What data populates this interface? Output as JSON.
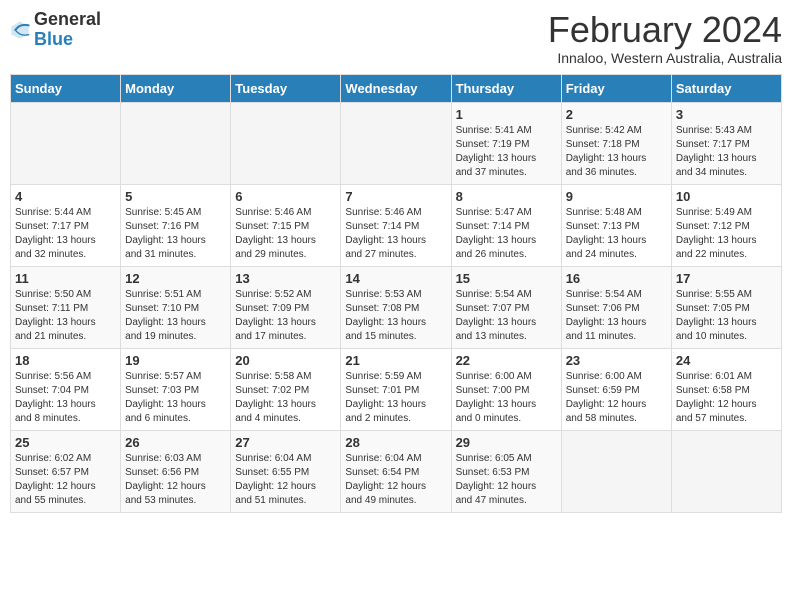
{
  "logo": {
    "general": "General",
    "blue": "Blue"
  },
  "header": {
    "month": "February 2024",
    "location": "Innaloo, Western Australia, Australia"
  },
  "weekdays": [
    "Sunday",
    "Monday",
    "Tuesday",
    "Wednesday",
    "Thursday",
    "Friday",
    "Saturday"
  ],
  "weeks": [
    [
      {
        "day": "",
        "info": ""
      },
      {
        "day": "",
        "info": ""
      },
      {
        "day": "",
        "info": ""
      },
      {
        "day": "",
        "info": ""
      },
      {
        "day": "1",
        "info": "Sunrise: 5:41 AM\nSunset: 7:19 PM\nDaylight: 13 hours\nand 37 minutes."
      },
      {
        "day": "2",
        "info": "Sunrise: 5:42 AM\nSunset: 7:18 PM\nDaylight: 13 hours\nand 36 minutes."
      },
      {
        "day": "3",
        "info": "Sunrise: 5:43 AM\nSunset: 7:17 PM\nDaylight: 13 hours\nand 34 minutes."
      }
    ],
    [
      {
        "day": "4",
        "info": "Sunrise: 5:44 AM\nSunset: 7:17 PM\nDaylight: 13 hours\nand 32 minutes."
      },
      {
        "day": "5",
        "info": "Sunrise: 5:45 AM\nSunset: 7:16 PM\nDaylight: 13 hours\nand 31 minutes."
      },
      {
        "day": "6",
        "info": "Sunrise: 5:46 AM\nSunset: 7:15 PM\nDaylight: 13 hours\nand 29 minutes."
      },
      {
        "day": "7",
        "info": "Sunrise: 5:46 AM\nSunset: 7:14 PM\nDaylight: 13 hours\nand 27 minutes."
      },
      {
        "day": "8",
        "info": "Sunrise: 5:47 AM\nSunset: 7:14 PM\nDaylight: 13 hours\nand 26 minutes."
      },
      {
        "day": "9",
        "info": "Sunrise: 5:48 AM\nSunset: 7:13 PM\nDaylight: 13 hours\nand 24 minutes."
      },
      {
        "day": "10",
        "info": "Sunrise: 5:49 AM\nSunset: 7:12 PM\nDaylight: 13 hours\nand 22 minutes."
      }
    ],
    [
      {
        "day": "11",
        "info": "Sunrise: 5:50 AM\nSunset: 7:11 PM\nDaylight: 13 hours\nand 21 minutes."
      },
      {
        "day": "12",
        "info": "Sunrise: 5:51 AM\nSunset: 7:10 PM\nDaylight: 13 hours\nand 19 minutes."
      },
      {
        "day": "13",
        "info": "Sunrise: 5:52 AM\nSunset: 7:09 PM\nDaylight: 13 hours\nand 17 minutes."
      },
      {
        "day": "14",
        "info": "Sunrise: 5:53 AM\nSunset: 7:08 PM\nDaylight: 13 hours\nand 15 minutes."
      },
      {
        "day": "15",
        "info": "Sunrise: 5:54 AM\nSunset: 7:07 PM\nDaylight: 13 hours\nand 13 minutes."
      },
      {
        "day": "16",
        "info": "Sunrise: 5:54 AM\nSunset: 7:06 PM\nDaylight: 13 hours\nand 11 minutes."
      },
      {
        "day": "17",
        "info": "Sunrise: 5:55 AM\nSunset: 7:05 PM\nDaylight: 13 hours\nand 10 minutes."
      }
    ],
    [
      {
        "day": "18",
        "info": "Sunrise: 5:56 AM\nSunset: 7:04 PM\nDaylight: 13 hours\nand 8 minutes."
      },
      {
        "day": "19",
        "info": "Sunrise: 5:57 AM\nSunset: 7:03 PM\nDaylight: 13 hours\nand 6 minutes."
      },
      {
        "day": "20",
        "info": "Sunrise: 5:58 AM\nSunset: 7:02 PM\nDaylight: 13 hours\nand 4 minutes."
      },
      {
        "day": "21",
        "info": "Sunrise: 5:59 AM\nSunset: 7:01 PM\nDaylight: 13 hours\nand 2 minutes."
      },
      {
        "day": "22",
        "info": "Sunrise: 6:00 AM\nSunset: 7:00 PM\nDaylight: 13 hours\nand 0 minutes."
      },
      {
        "day": "23",
        "info": "Sunrise: 6:00 AM\nSunset: 6:59 PM\nDaylight: 12 hours\nand 58 minutes."
      },
      {
        "day": "24",
        "info": "Sunrise: 6:01 AM\nSunset: 6:58 PM\nDaylight: 12 hours\nand 57 minutes."
      }
    ],
    [
      {
        "day": "25",
        "info": "Sunrise: 6:02 AM\nSunset: 6:57 PM\nDaylight: 12 hours\nand 55 minutes."
      },
      {
        "day": "26",
        "info": "Sunrise: 6:03 AM\nSunset: 6:56 PM\nDaylight: 12 hours\nand 53 minutes."
      },
      {
        "day": "27",
        "info": "Sunrise: 6:04 AM\nSunset: 6:55 PM\nDaylight: 12 hours\nand 51 minutes."
      },
      {
        "day": "28",
        "info": "Sunrise: 6:04 AM\nSunset: 6:54 PM\nDaylight: 12 hours\nand 49 minutes."
      },
      {
        "day": "29",
        "info": "Sunrise: 6:05 AM\nSunset: 6:53 PM\nDaylight: 12 hours\nand 47 minutes."
      },
      {
        "day": "",
        "info": ""
      },
      {
        "day": "",
        "info": ""
      }
    ]
  ]
}
